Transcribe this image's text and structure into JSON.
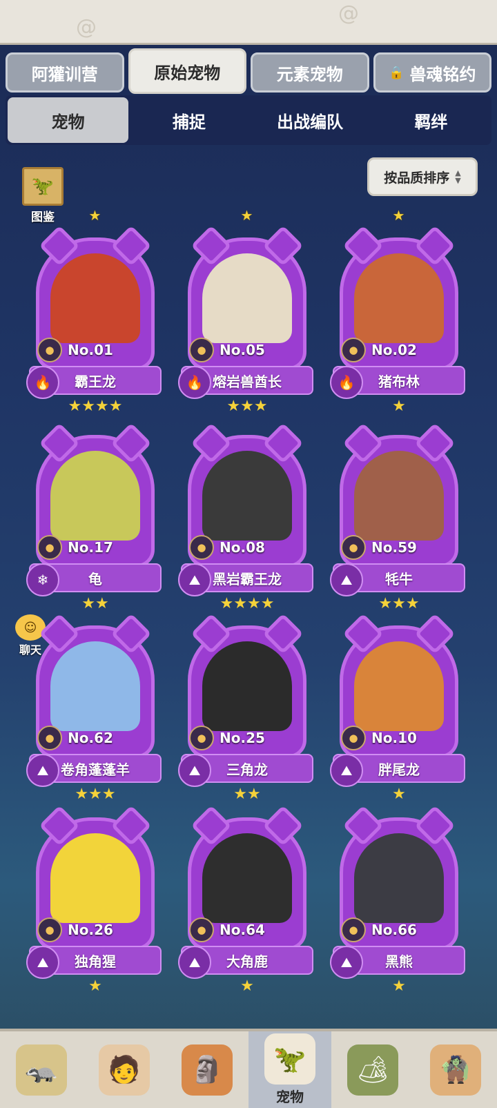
{
  "top_tabs": [
    "阿獾训营",
    "原始宠物",
    "元素宠物",
    "兽魂铭约"
  ],
  "sub_tabs": [
    "宠物",
    "捕捉",
    "出战编队",
    "羁绊"
  ],
  "codex_label": "图鉴",
  "sort_label": "按品质排序",
  "chat_label": "聊天",
  "bottom_active_label": "宠物",
  "pets": [
    {
      "no": "No.01",
      "name": "霸王龙",
      "stars_above": "★",
      "stars_below": "★★★★",
      "element": "fire",
      "portrait_color": "#c9452d"
    },
    {
      "no": "No.05",
      "name": "熔岩兽酋长",
      "stars_above": "★",
      "stars_below": "★★★",
      "element": "fire",
      "portrait_color": "#e6dbc6"
    },
    {
      "no": "No.02",
      "name": "猪布林",
      "stars_above": "★",
      "stars_below": "★",
      "element": "fire",
      "portrait_color": "#c9663a"
    },
    {
      "no": "No.17",
      "name": "龟",
      "stars_above": "",
      "stars_below": "★★",
      "element": "ice",
      "portrait_color": "#c8c85a"
    },
    {
      "no": "No.08",
      "name": "黑岩霸王龙",
      "stars_above": "",
      "stars_below": "★★★★",
      "element": "earth",
      "portrait_color": "#3a3a3a"
    },
    {
      "no": "No.59",
      "name": "牦牛",
      "stars_above": "",
      "stars_below": "★★★",
      "element": "earth",
      "portrait_color": "#a0604a"
    },
    {
      "no": "No.62",
      "name": "卷角蓬蓬羊",
      "stars_above": "",
      "stars_below": "★★★",
      "element": "earth",
      "portrait_color": "#8fb8e8"
    },
    {
      "no": "No.25",
      "name": "三角龙",
      "stars_above": "",
      "stars_below": "★★",
      "element": "earth",
      "portrait_color": "#2b2b2b"
    },
    {
      "no": "No.10",
      "name": "胖尾龙",
      "stars_above": "",
      "stars_below": "★",
      "element": "earth",
      "portrait_color": "#d9843a"
    },
    {
      "no": "No.26",
      "name": "独角猩",
      "stars_above": "",
      "stars_below": "★",
      "element": "earth",
      "portrait_color": "#f2d43a"
    },
    {
      "no": "No.64",
      "name": "大角鹿",
      "stars_above": "",
      "stars_below": "★",
      "element": "earth",
      "portrait_color": "#2e2e2e"
    },
    {
      "no": "No.66",
      "name": "黑熊",
      "stars_above": "",
      "stars_below": "★",
      "element": "earth",
      "portrait_color": "#3c3c44"
    }
  ],
  "colors": {
    "card_purple": "#9b3dd1",
    "star": "#f5d23a",
    "bg": "#1f3565"
  }
}
